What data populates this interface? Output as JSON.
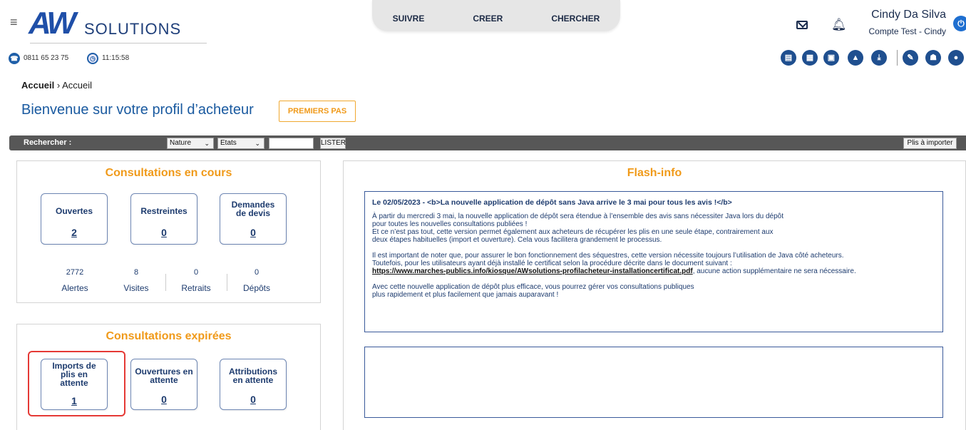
{
  "header": {
    "logo_mark": "AW",
    "logo_text": "SOLUTIONS",
    "nav": [
      "SUIVRE",
      "CREER",
      "CHERCHER"
    ],
    "user_name": "Cindy Da Silva",
    "user_account": "Compte Test - Cindy"
  },
  "info": {
    "phone": "0811 65 23 75",
    "time": "11:15:58"
  },
  "toolbar": {
    "icons": [
      "document-icon",
      "calculator-icon",
      "file-icon",
      "marco-icon",
      "download-icon",
      "edit-icon",
      "family-icon",
      "user-settings-icon"
    ]
  },
  "breadcrumb": {
    "root": "Accueil",
    "separator": "›",
    "current": "Accueil"
  },
  "page": {
    "title": "Bienvenue sur votre profil d’acheteur",
    "first_steps": "PREMIERS PAS"
  },
  "search": {
    "label": "Rechercher :",
    "nature": "Nature",
    "etats": "Etats",
    "list_button": "LISTER",
    "import_button": "Plis à importer"
  },
  "current_consultations": {
    "title": "Consultations en cours",
    "tiles": [
      {
        "label": "Ouvertes",
        "value": "2"
      },
      {
        "label": "Restreintes",
        "value": "0"
      },
      {
        "label": "Demandes de devis",
        "value": "0"
      }
    ],
    "stats": [
      {
        "value": "2772",
        "label": "Alertes"
      },
      {
        "value": "8",
        "label": "Visites"
      },
      {
        "value": "0",
        "label": "Retraits"
      },
      {
        "value": "0",
        "label": "Dépôts"
      }
    ]
  },
  "expired_consultations": {
    "title": "Consultations expirées",
    "tiles": [
      {
        "label": "Imports de plis en attente",
        "value": "1"
      },
      {
        "label": "Ouvertures en attente",
        "value": "0"
      },
      {
        "label": "Attributions en attente",
        "value": "0"
      }
    ]
  },
  "flash": {
    "title": "Flash-info",
    "headline": "Le 02/05/2023 - <b>La nouvelle application de dépôt sans Java arrive le 3 mai pour tous les avis !</b>",
    "p1_l1": "À partir du mercredi 3 mai, la nouvelle application de dépôt sera étendue à l’ensemble des avis sans nécessiter Java lors du dépôt",
    "p1_l2": "pour toutes les nouvelles consultations publiées !",
    "p1_l3": "Et ce n’est pas tout, cette version permet également aux acheteurs de récupérer les plis en une seule étape, contrairement aux",
    "p1_l4": "deux étapes habituelles (import et ouverture). Cela vous facilitera grandement le processus.",
    "p2_l1": "Il est important de noter que, pour assurer le bon fonctionnement des séquestres, cette version nécessite toujours l’utilisation de Java côté acheteurs.",
    "p2_l2": "Toutefois, pour les utilisateurs ayant déjà installé le certificat selon la procédure décrite dans le document suivant :",
    "link": "https://www.marches-publics.info/kiosque/AWsolutions-profilacheteur-installationcertificat.pdf",
    "p2_l3_rest": ", aucune action supplémentaire ne sera nécessaire.",
    "p3_l1": "Avec cette nouvelle application de dépôt plus efficace, vous pourrez gérer vos consultations publiques",
    "p3_l2": "plus rapidement et plus facilement que jamais auparavant !"
  },
  "colors": {
    "brand_blue": "#1f4fa8",
    "accent_orange": "#f09a1a",
    "highlight_red": "#e53935"
  }
}
